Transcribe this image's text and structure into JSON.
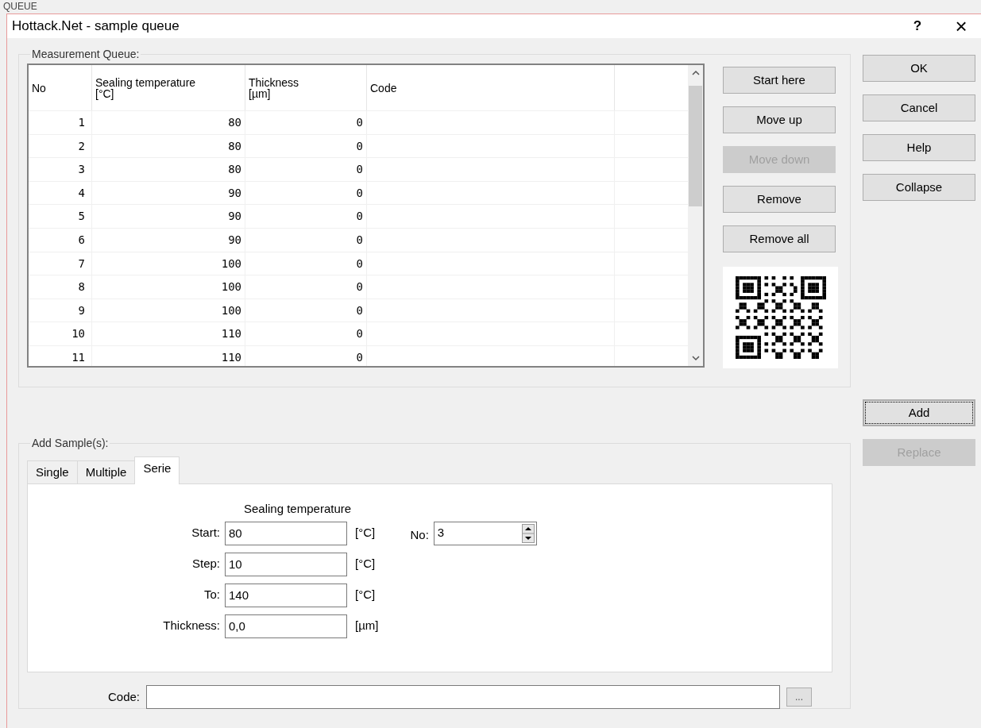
{
  "top_label": "QUEUE",
  "window": {
    "title": "Hottack.Net - sample queue",
    "help": "?",
    "close": "×"
  },
  "queue": {
    "label": "Measurement Queue:",
    "columns": [
      {
        "title": "No"
      },
      {
        "title": "Sealing temperature",
        "unit": "[°C]"
      },
      {
        "title": "Thickness",
        "unit": "[µm]"
      },
      {
        "title": "Code"
      }
    ],
    "rows": [
      {
        "no": "1",
        "temperature": "80",
        "thickness": "0"
      },
      {
        "no": "2",
        "temperature": "80",
        "thickness": "0"
      },
      {
        "no": "3",
        "temperature": "80",
        "thickness": "0"
      },
      {
        "no": "4",
        "temperature": "90",
        "thickness": "0"
      },
      {
        "no": "5",
        "temperature": "90",
        "thickness": "0"
      },
      {
        "no": "6",
        "temperature": "90",
        "thickness": "0"
      },
      {
        "no": "7",
        "temperature": "100",
        "thickness": "0"
      },
      {
        "no": "8",
        "temperature": "100",
        "thickness": "0"
      },
      {
        "no": "9",
        "temperature": "100",
        "thickness": "0"
      },
      {
        "no": "10",
        "temperature": "110",
        "thickness": "0"
      },
      {
        "no": "11",
        "temperature": "110",
        "thickness": "0"
      }
    ],
    "buttons": [
      {
        "label": "Start here",
        "disabled": false
      },
      {
        "label": "Move up",
        "disabled": false
      },
      {
        "label": "Move down",
        "disabled": true
      },
      {
        "label": "Remove",
        "disabled": false
      },
      {
        "label": "Remove all",
        "disabled": false
      }
    ]
  },
  "dialog_buttons": [
    {
      "label": "OK"
    },
    {
      "label": "Cancel"
    },
    {
      "label": "Help"
    },
    {
      "label": "Collapse"
    }
  ],
  "sample_buttons": [
    {
      "label": "Add",
      "disabled": false,
      "focused": true
    },
    {
      "label": "Replace",
      "disabled": true,
      "focused": false
    }
  ],
  "add_sample": {
    "label": "Add Sample(s):",
    "tabs": [
      {
        "label": "Single",
        "selected": false
      },
      {
        "label": "Multiple",
        "selected": false
      },
      {
        "label": "Serie",
        "selected": true
      }
    ],
    "heading": "Sealing temperature",
    "fields": [
      {
        "label": "Start:",
        "value": "80",
        "unit": "[°C]"
      },
      {
        "label": "Step:",
        "value": "10",
        "unit": "[°C]"
      },
      {
        "label": "To:",
        "value": "140",
        "unit": "[°C]"
      },
      {
        "label": "Thickness:",
        "value": "0,0",
        "unit": "[µm]"
      }
    ],
    "count": {
      "label": "No:",
      "value": "3"
    },
    "code": {
      "label": "Code:",
      "browse": "..."
    }
  }
}
